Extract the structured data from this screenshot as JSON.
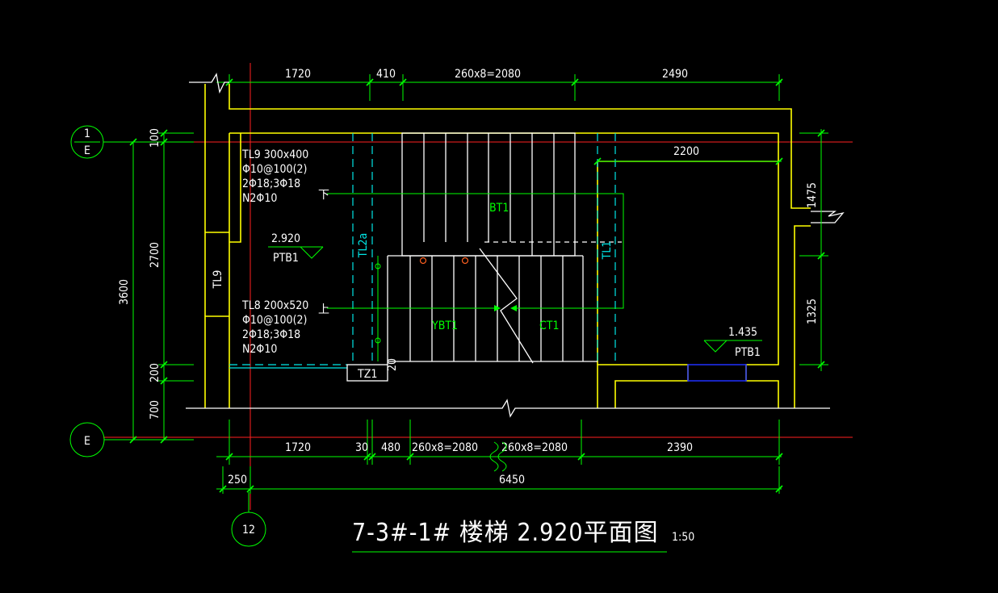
{
  "title": {
    "main": "7-3#-1# 楼梯  2.920平面图",
    "scale": "1:50"
  },
  "axes": {
    "axis_1e_top": "1",
    "axis_1e_bottom": "E",
    "axis_e": "E",
    "axis_12": "12"
  },
  "dims": {
    "top": [
      "1720",
      "410",
      "260x8=2080",
      "2490"
    ],
    "bottom": [
      "1720",
      "30",
      "480",
      "260x8=2080",
      "260x8=2080",
      "2390"
    ],
    "bottom_250": "250",
    "overall": "6450",
    "left": [
      "100",
      "2700",
      "200",
      "700"
    ],
    "left_total": "3600",
    "right": [
      "1475",
      "1325"
    ],
    "inner_2200": "2200"
  },
  "labels": {
    "tl9_lines": [
      "TL9  300x400",
      "Φ10@100(2)",
      "2Φ18;3Φ18",
      "N2Φ10"
    ],
    "tl8_lines": [
      "TL8  200x520",
      "Φ10@100(2)",
      "2Φ18;3Φ18",
      "N2Φ10"
    ],
    "elev_1": "2.920",
    "ptb_1": "PTB1",
    "elev_2": "1.435",
    "ptb_2": "PTB1",
    "tl9_vert": "TL9",
    "tl2a": "TL2a",
    "tl1": "TL1",
    "bt1": "BT1",
    "ybt1": "YBT1",
    "ct1": "CT1",
    "tz1": "TZ1",
    "small_20": "20",
    "down": "下",
    "up": "上"
  },
  "colors": {
    "background": "#000000",
    "wall": "#ffff00",
    "dimension": "#00ff00",
    "axis": "#ff2020",
    "beam": "#00e5e5",
    "text": "#ffffff"
  }
}
